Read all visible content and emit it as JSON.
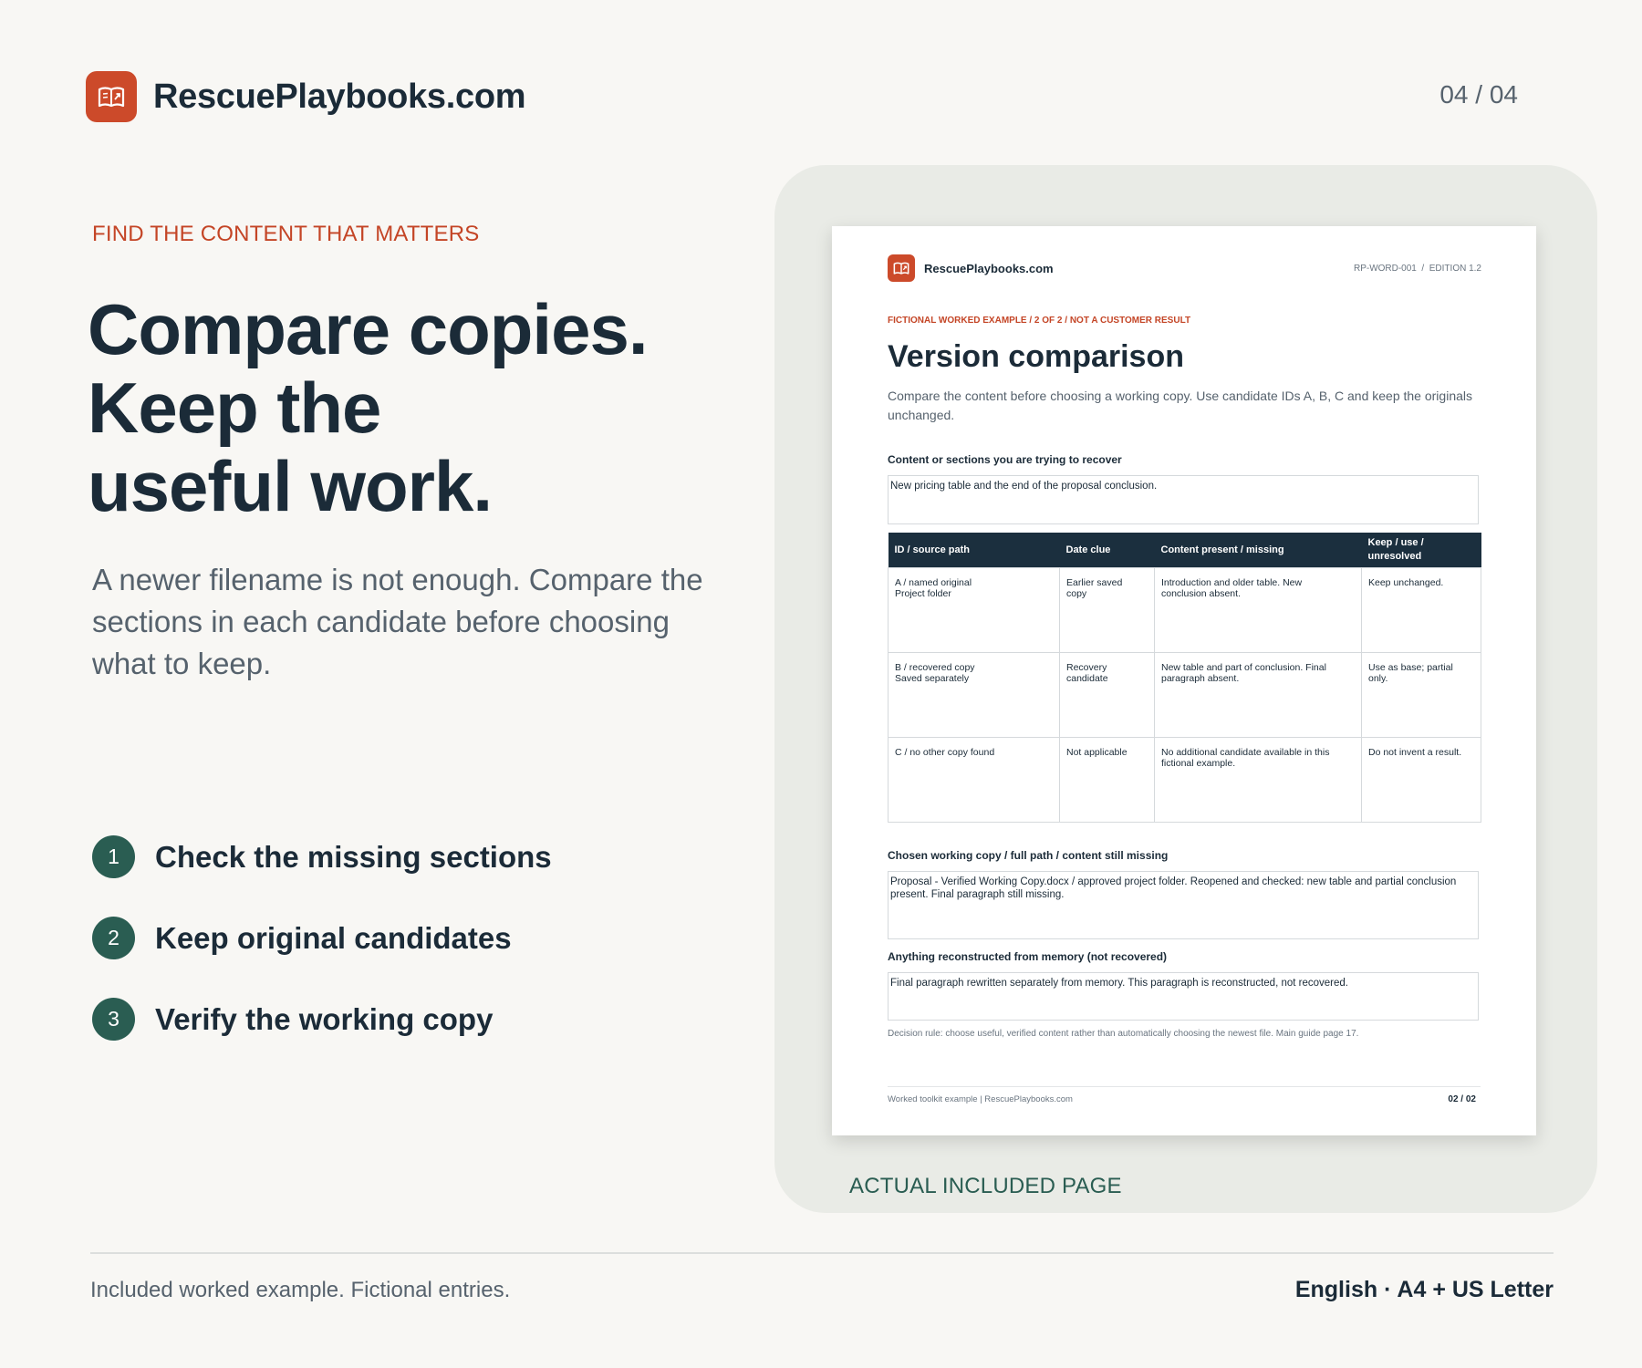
{
  "header": {
    "brand_name": "RescuePlaybooks.com",
    "logo_icon": "open-book-icon",
    "page_indicator": "04 / 04"
  },
  "hero": {
    "eyebrow": "FIND THE CONTENT THAT MATTERS",
    "headline_lines": [
      "Compare copies.",
      "Keep the",
      "useful work."
    ],
    "lead": "A newer filename is not enough. Compare the sections in each candidate before choosing what to keep."
  },
  "steps": [
    {
      "number": "1",
      "label": "Check the missing sections"
    },
    {
      "number": "2",
      "label": "Keep original candidates"
    },
    {
      "number": "3",
      "label": "Verify the working copy"
    }
  ],
  "preview": {
    "caption": "ACTUAL INCLUDED PAGE",
    "document": {
      "brand_name": "RescuePlaybooks.com",
      "meta": "RP-WORD-001  /  EDITION 1.2",
      "tag": "FICTIONAL WORKED EXAMPLE / 2 OF 2 / NOT A CUSTOMER RESULT",
      "title": "Version comparison",
      "intro": "Compare the content before choosing a working copy. Use candidate IDs A, B, C and keep the originals unchanged.",
      "recover_label": "Content or sections you are trying to recover",
      "recover_value": "New pricing table and the end of the proposal conclusion.",
      "table": {
        "headers": [
          "ID / source path",
          "Date clue",
          "Content present / missing",
          "Keep / use / unresolved"
        ],
        "rows": [
          [
            [
              "A / named original",
              "Project folder"
            ],
            [
              "Earlier saved",
              "copy"
            ],
            [
              "Introduction and older table. New",
              "conclusion absent."
            ],
            [
              "Keep unchanged."
            ]
          ],
          [
            [
              "B / recovered copy",
              "Saved separately"
            ],
            [
              "Recovery",
              "candidate"
            ],
            [
              "New table and part of conclusion. Final",
              "paragraph absent."
            ],
            [
              "Use as base; partial",
              "only."
            ]
          ],
          [
            [
              "C / no other copy found"
            ],
            [
              "Not applicable"
            ],
            [
              "No additional candidate available in this",
              "fictional example."
            ],
            [
              "Do not invent a result."
            ]
          ]
        ]
      },
      "chosen_label": "Chosen working copy / full path / content still missing",
      "chosen_value": "Proposal - Verified Working Copy.docx / approved project folder. Reopened and checked: new table and partial conclusion present. Final paragraph still missing.",
      "memory_label": "Anything reconstructed from memory (not recovered)",
      "memory_value": "Final paragraph rewritten separately from memory. This paragraph is reconstructed, not recovered.",
      "decision_rule": "Decision rule: choose useful, verified content rather than automatically choosing the newest file. Main guide page 17.",
      "footer_left": "Worked toolkit example | RescuePlaybooks.com",
      "footer_page": "02 / 02"
    }
  },
  "footer": {
    "left": "Included worked example. Fictional entries.",
    "right": "English · A4 + US Letter"
  },
  "colors": {
    "accent": "#cc4a2a",
    "navy": "#1b2b38",
    "green": "#2a5d52",
    "background": "#f8f7f4"
  }
}
